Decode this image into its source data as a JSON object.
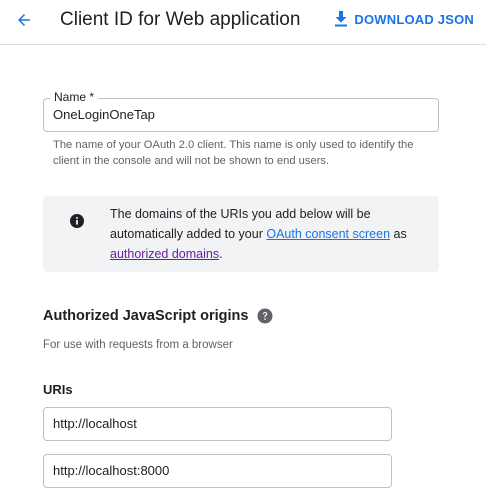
{
  "header": {
    "back_icon": "arrow-left-icon",
    "title": "Client ID for Web application",
    "download_icon": "download-icon",
    "download_label": "DOWNLOAD JSON",
    "accent_color": "#1a73e8"
  },
  "name_field": {
    "label": "Name *",
    "value": "OneLoginOneTap",
    "hint": "The name of your OAuth 2.0 client. This name is only used to identify the client in the console and will not be shown to end users."
  },
  "info_box": {
    "icon": "info-icon",
    "text_before": "The domains of the URIs you add below will be automatically added to your ",
    "link1": "OAuth consent screen",
    "text_middle": " as ",
    "link2": "authorized domains",
    "text_after": "."
  },
  "js_origins": {
    "title": "Authorized JavaScript origins",
    "help_icon": "help-icon",
    "subtitle": "For use with requests from a browser",
    "uris_label": "URIs",
    "uris": [
      "http://localhost",
      "http://localhost:8000"
    ]
  }
}
